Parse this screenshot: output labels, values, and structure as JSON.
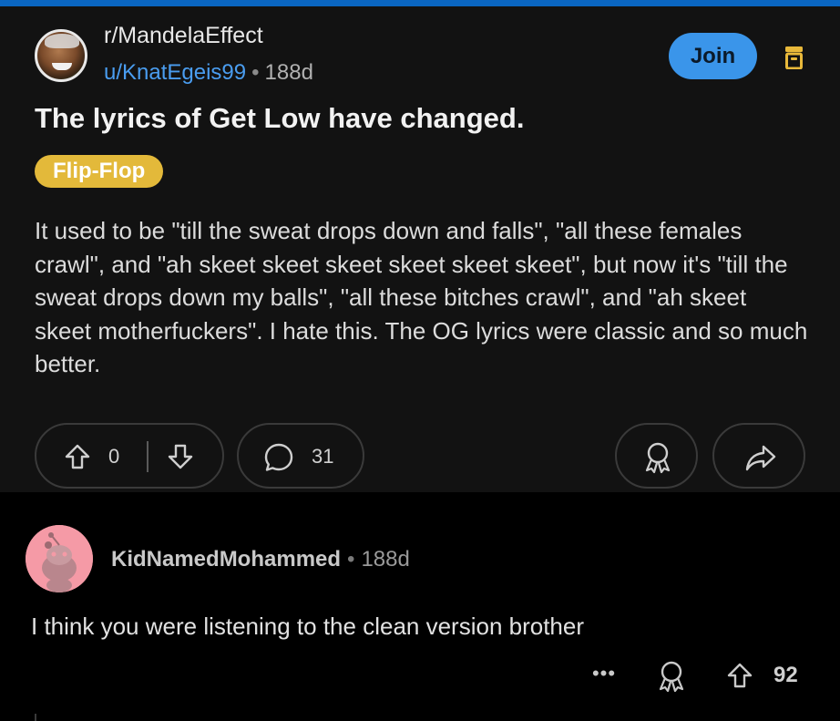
{
  "post": {
    "subreddit": "r/MandelaEffect",
    "author": "u/KnatEgeis99",
    "separator": "•",
    "age": "188d",
    "join_label": "Join",
    "title": "The lyrics of Get Low have changed.",
    "flair": "Flip-Flop",
    "body": "It used to be \"till the sweat drops down and falls\", \"all these females crawl\", and \"ah skeet skeet skeet skeet skeet skeet\", but now it's \"till the sweat drops down my balls\", \"all these bitches crawl\", and \"ah skeet skeet motherfuckers\". I hate this. The OG lyrics were classic and so much better.",
    "score": "0",
    "comment_count": "31",
    "icons": [
      "archive-icon",
      "upvote-icon",
      "downvote-icon",
      "comment-icon",
      "award-icon",
      "share-icon"
    ]
  },
  "comment": {
    "author": "KidNamedMohammed",
    "separator": "•",
    "age": "188d",
    "text": "I think you were listening to the clean version brother",
    "more_label": "•••",
    "score": "92",
    "icons": [
      "more-icon",
      "award-icon",
      "upvote-icon"
    ]
  },
  "colors": {
    "accent_bar": "#0a66c2",
    "join_button": "#3a95ea",
    "username_link": "#4a9df0",
    "flair_bg": "#e3b93a",
    "archive_icon": "#e8b83a",
    "comment_avatar": "#f59aa6"
  }
}
